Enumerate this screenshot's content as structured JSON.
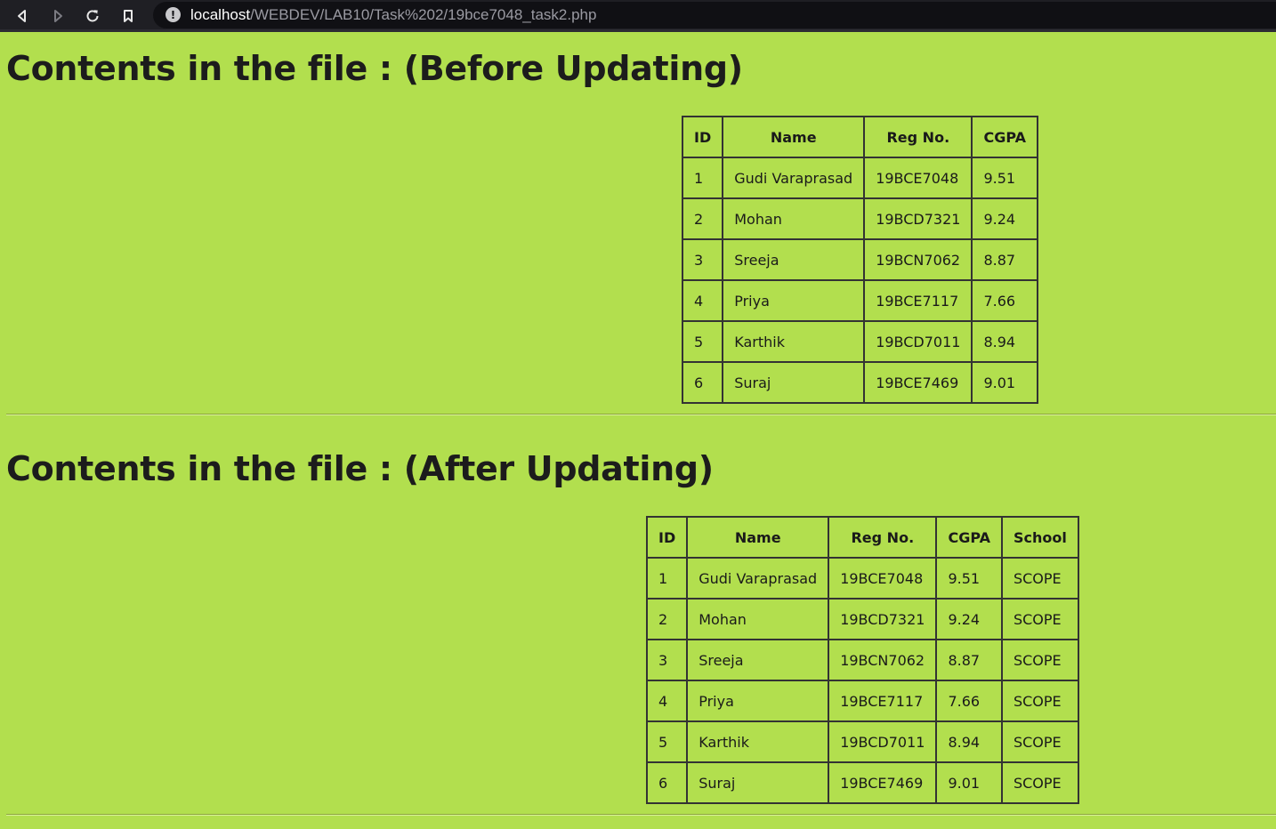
{
  "browser": {
    "url_host": "localhost",
    "url_path": "/WEBDEV/LAB10/Task%202/19bce7048_task2.php",
    "icons": [
      "back-icon",
      "forward-icon",
      "reload-icon",
      "bookmark-icon",
      "info-icon"
    ]
  },
  "colors": {
    "page_background": "#b2df4e",
    "browser_bar": "#1f1f24"
  },
  "before": {
    "title": "Contents in the file : (Before Updating)",
    "headers": [
      "ID",
      "Name",
      "Reg No.",
      "CGPA"
    ],
    "rows": [
      [
        "1",
        "Gudi Varaprasad",
        "19BCE7048",
        "9.51"
      ],
      [
        "2",
        "Mohan",
        "19BCD7321",
        "9.24"
      ],
      [
        "3",
        "Sreeja",
        "19BCN7062",
        "8.87"
      ],
      [
        "4",
        "Priya",
        "19BCE7117",
        "7.66"
      ],
      [
        "5",
        "Karthik",
        "19BCD7011",
        "8.94"
      ],
      [
        "6",
        "Suraj",
        "19BCE7469",
        "9.01"
      ]
    ]
  },
  "after": {
    "title": "Contents in the file : (After Updating)",
    "headers": [
      "ID",
      "Name",
      "Reg No.",
      "CGPA",
      "School"
    ],
    "rows": [
      [
        "1",
        "Gudi Varaprasad",
        "19BCE7048",
        "9.51",
        "SCOPE"
      ],
      [
        "2",
        "Mohan",
        "19BCD7321",
        "9.24",
        "SCOPE"
      ],
      [
        "3",
        "Sreeja",
        "19BCN7062",
        "8.87",
        "SCOPE"
      ],
      [
        "4",
        "Priya",
        "19BCE7117",
        "7.66",
        "SCOPE"
      ],
      [
        "5",
        "Karthik",
        "19BCD7011",
        "8.94",
        "SCOPE"
      ],
      [
        "6",
        "Suraj",
        "19BCE7469",
        "9.01",
        "SCOPE"
      ]
    ]
  }
}
